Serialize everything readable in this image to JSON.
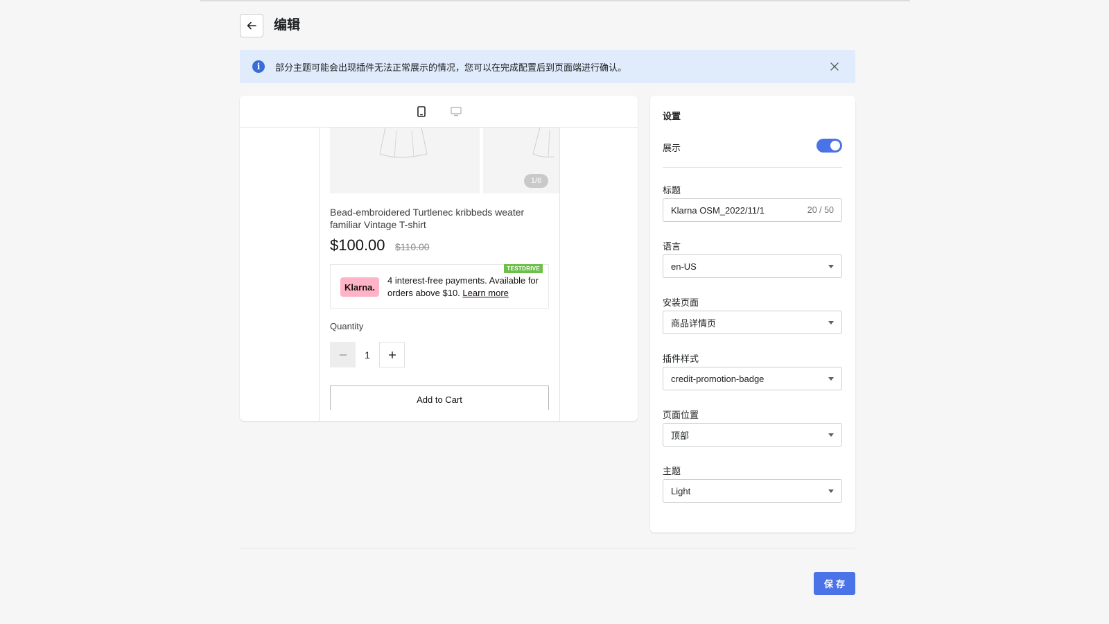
{
  "header": {
    "title": "编辑"
  },
  "banner": {
    "message": "部分主题可能会出现插件无法正常展示的情况，您可以在完成配置后到页面端进行确认。"
  },
  "preview": {
    "image_counter": "1/6",
    "product_title": "Bead-embroidered Turtlenec kribbeds weater familiar Vintage T-shirt",
    "price": "$100.00",
    "compare_price": "$110.00",
    "klarna": {
      "logo_text": "Klarna.",
      "badge": "TESTDRIVE",
      "message": "4 interest-free payments. Available for orders above $10.",
      "link_text": "Learn more"
    },
    "quantity_label": "Quantity",
    "quantity_value": "1",
    "add_to_cart": "Add to Cart"
  },
  "settings": {
    "title": "设置",
    "show_label": "展示",
    "show_enabled": true,
    "fields": {
      "title_label": "标题",
      "title_value": "Klarna OSM_2022/11/1",
      "title_count": "20 / 50",
      "language_label": "语言",
      "language_value": "en-US",
      "install_page_label": "安装页面",
      "install_page_value": "商品详情页",
      "style_label": "插件样式",
      "style_value": "credit-promotion-badge",
      "position_label": "页面位置",
      "position_value": "顶部",
      "theme_label": "主题",
      "theme_value": "Light"
    }
  },
  "footer": {
    "save_label": "保存"
  },
  "colors": {
    "accent": "#4a73e8",
    "banner_bg": "#e0ebfc",
    "klarna_pink": "#ffb3c7",
    "testdrive_green": "#6cc04a"
  }
}
